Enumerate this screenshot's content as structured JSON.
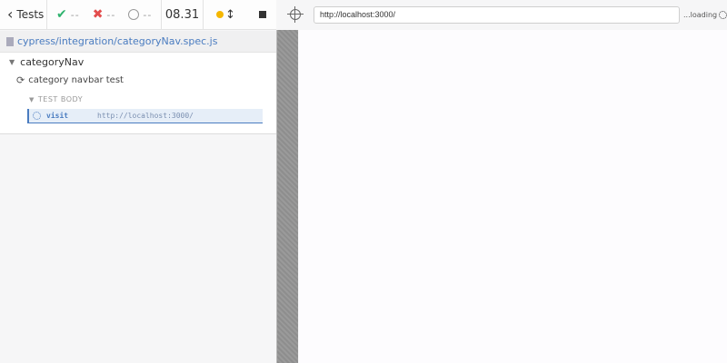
{
  "header": {
    "tests_label": "Tests",
    "passed": "--",
    "failed": "--",
    "pending": "--",
    "duration": "08.31"
  },
  "spec": {
    "path": "cypress/integration/categoryNav.spec.js"
  },
  "runnables": {
    "suite": "categoryNav",
    "test": "category navbar test",
    "body_label": "TEST BODY",
    "command": {
      "name": "visit",
      "message": "http://localhost:3000/"
    }
  },
  "aut": {
    "url": "http://localhost:3000/",
    "status": "...loading"
  },
  "colors": {
    "pass": "#2fb36e",
    "fail": "#e34d4d",
    "running": "#f5b700",
    "link": "#4a7cc0"
  }
}
